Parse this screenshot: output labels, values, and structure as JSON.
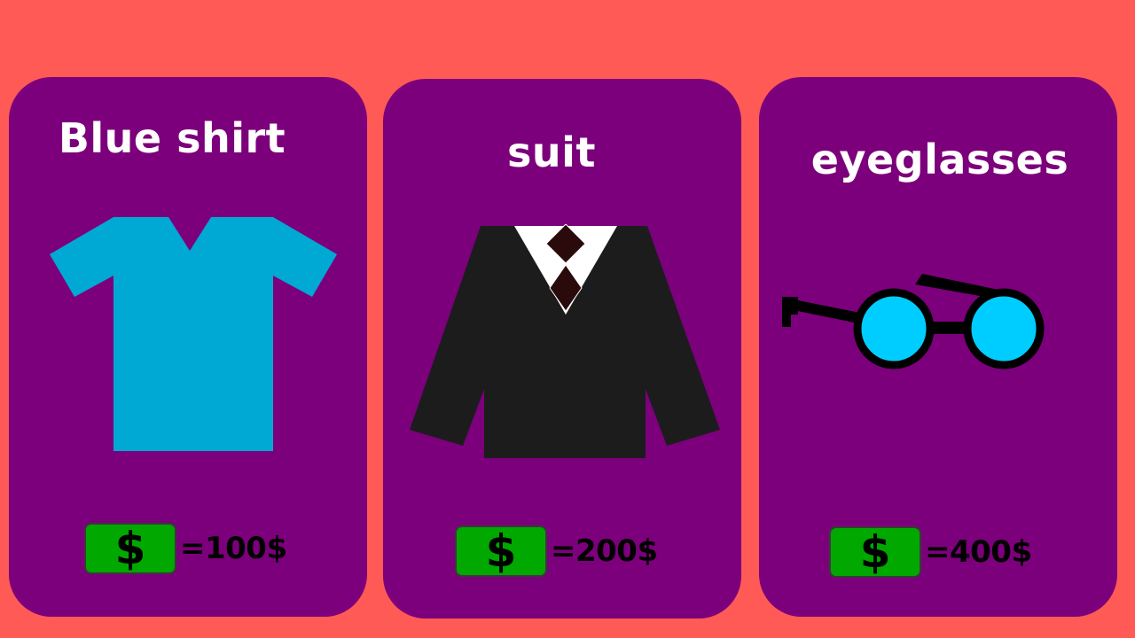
{
  "items": [
    {
      "name": "Blue shirt",
      "price_label": "=100$",
      "price_value": 100,
      "icon": "tshirt-icon",
      "color": "#00a8d4"
    },
    {
      "name": "suit",
      "price_label": "=200$",
      "price_value": 200,
      "icon": "suit-icon",
      "color": "#1c1c1c"
    },
    {
      "name": "eyeglasses",
      "price_label": "=400$",
      "price_value": 400,
      "icon": "eyeglasses-icon",
      "color": "#00cdff"
    }
  ],
  "currency_symbol": "$",
  "colors": {
    "background": "#ff5a55",
    "card": "#7c007b",
    "bill": "#00a800"
  }
}
